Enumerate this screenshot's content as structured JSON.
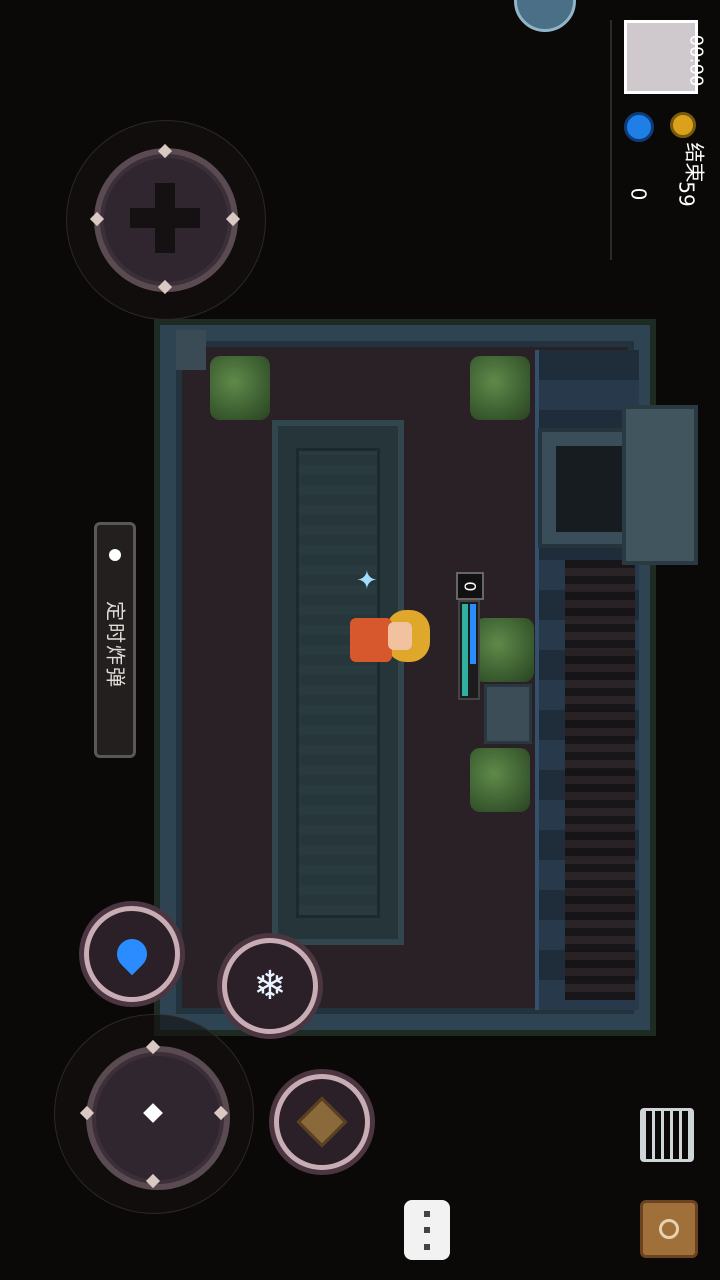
{
  "hud": {
    "timer": "00:00",
    "end_label": "结束",
    "gold": "59",
    "gems": "0"
  },
  "bomb_panel": {
    "label": "定时炸弹"
  },
  "player": {
    "level": "0"
  },
  "icons": {
    "gem": "blue-gem-icon",
    "coin": "gold-coin-icon",
    "skill_1": "blue-flame-icon",
    "skill_2": "snowflake-icon",
    "weapon": "crate-weapon-icon",
    "chat": "chat-bubble-icon",
    "shop": "cart-icon",
    "backpack": "backpack-icon"
  },
  "colors": {
    "wall": "#2e4452",
    "floor": "#2a2127",
    "accent_blue": "#2a8cff",
    "health": "#2fb0a0"
  }
}
